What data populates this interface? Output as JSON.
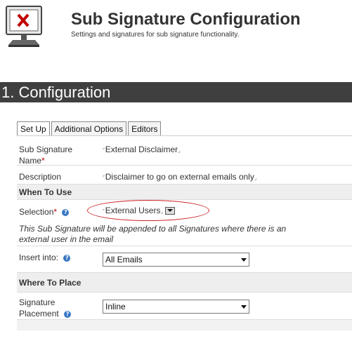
{
  "header": {
    "title": "Sub Signature Configuration",
    "subtitle": "Settings and signatures for sub signature functionality."
  },
  "section": {
    "title": "1. Configuration"
  },
  "tabs": [
    {
      "label": "Set Up",
      "active": true
    },
    {
      "label": "Additional Options",
      "active": false
    },
    {
      "label": "Editors",
      "active": false
    }
  ],
  "form": {
    "sub_signature_name": {
      "label": "Sub Signature Name",
      "required_mark": "*",
      "value": "External Disclaimer"
    },
    "description": {
      "label": "Description",
      "value": "Disclaimer to go on external emails only"
    },
    "when_to_use": {
      "heading": "When To Use"
    },
    "selection": {
      "label": "Selection",
      "required_mark": "*",
      "value": "External Users"
    },
    "selection_note": "This Sub Signature will be appended to all Signatures  where there is an external user in the email",
    "insert_into": {
      "label": "Insert into:",
      "value": "All Emails"
    },
    "where_to_place": {
      "heading": "Where To Place"
    },
    "signature_placement": {
      "label": "Signature Placement",
      "value": "Inline"
    }
  },
  "icons": {
    "logo": "monitor-error-icon",
    "help": "help-icon"
  },
  "colors": {
    "section_bar": "#3f3f3f",
    "required": "#c00000",
    "help_icon": "#3a78c4",
    "highlight_oval": "#cc2222"
  }
}
